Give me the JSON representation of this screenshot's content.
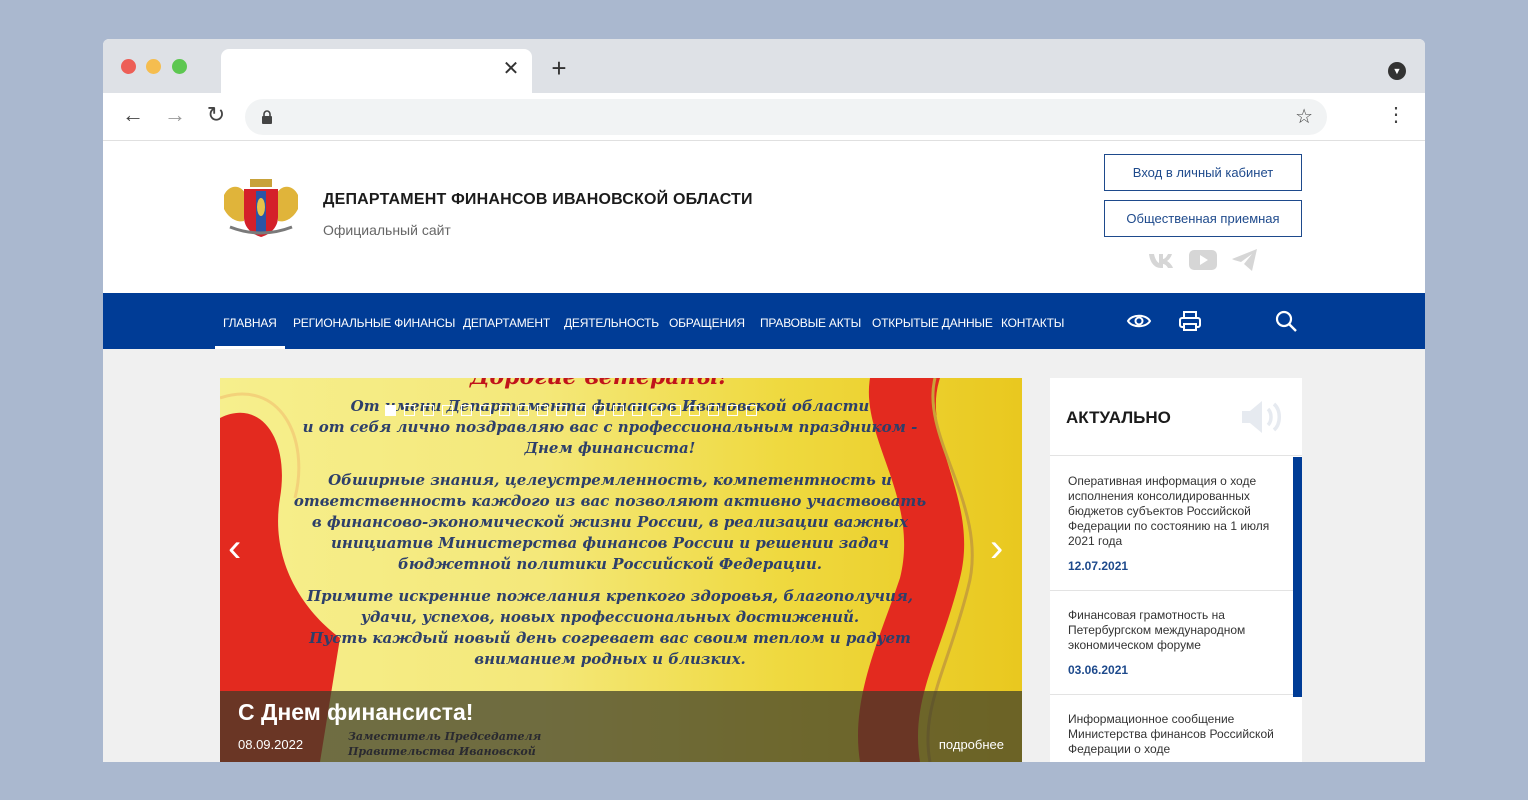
{
  "browser": {
    "tab_close": "✕",
    "new_tab": "+",
    "back": "←",
    "forward": "→",
    "reload": "↻",
    "star": "☆",
    "menu": "⋮",
    "profile_menu": "▼"
  },
  "header": {
    "title": "ДЕПАРТАМЕНТ ФИНАНСОВ ИВАНОВСКОЙ ОБЛАСТИ",
    "subtitle": "Официальный сайт",
    "buttons": {
      "cabinet": "Вход в личный кабинет",
      "reception": "Общественная приемная"
    },
    "social": [
      "vk-icon",
      "youtube-icon",
      "telegram-icon"
    ]
  },
  "nav": {
    "items": [
      {
        "label": "ГЛАВНАЯ",
        "active": true
      },
      {
        "label": "РЕГИОНАЛЬНЫЕ ФИНАНСЫ"
      },
      {
        "label": "ДЕПАРТАМЕНТ"
      },
      {
        "label": "ДЕЯТЕЛЬНОСТЬ"
      },
      {
        "label": "ОБРАЩЕНИЯ"
      },
      {
        "label": "ПРАВОВЫЕ АКТЫ"
      },
      {
        "label": "ОТКРЫТЫЕ ДАННЫЕ"
      },
      {
        "label": "КОНТАКТЫ"
      }
    ],
    "tools": [
      "eye-icon",
      "print-icon",
      "search-icon"
    ]
  },
  "slider": {
    "heading": "Дорогие ветераны!",
    "paragraphs": [
      "От имени Департамента финансов Ивановской области\nи от себя лично поздравляю вас с профессиональным праздником -\nДнем финансиста!",
      "Обширные знания, целеустремленность, компетентность и\nответственность каждого из вас позволяют активно участвовать\nв финансово-экономической жизни России, в реализации важных\nинициатив Министерства финансов России и решении задач\nбюджетной политики Российской Федерации.",
      "Примите искренние пожелания крепкого здоровья, благополучия,\nудачи, успехов, новых профессиональных достижений.\nПусть каждый новый день согревает вас своим теплом и радует\nвниманием родных и близких."
    ],
    "signature": "Заместитель Председателя\nПравительства Ивановской",
    "slide_count": 20,
    "active_slide": 1,
    "prev": "‹",
    "next": "›",
    "caption": {
      "title": "С Днем финансиста!",
      "date": "08.09.2022",
      "more": "подробнее"
    }
  },
  "aside": {
    "title": "АКТУАЛЬНО",
    "news": [
      {
        "text": "Оперативная информация о ходе исполнения консолидированных бюджетов субъектов Российской Федерации по состоянию на 1 июля 2021 года",
        "date": "12.07.2021"
      },
      {
        "text": "Финансовая грамотность на Петербургском международном экономическом форуме",
        "date": "03.06.2021"
      },
      {
        "text": "Информационное сообщение Министерства финансов Российской Федерации о ходе",
        "date": ""
      }
    ]
  },
  "colors": {
    "brand_blue": "#003c96",
    "link_blue": "#1e4a8c"
  }
}
